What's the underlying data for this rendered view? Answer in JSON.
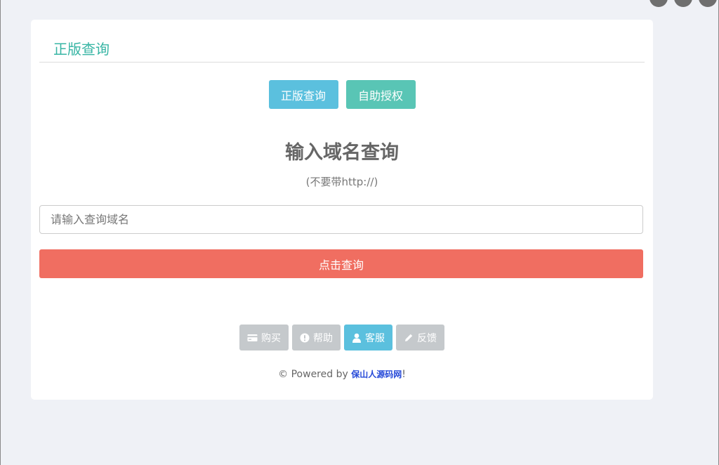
{
  "card": {
    "title": "正版查询"
  },
  "tabs": {
    "query_label": "正版查询",
    "authorize_label": "自助授权"
  },
  "main": {
    "heading": "输入域名查询",
    "subheading": "(不要带http://)",
    "input_placeholder": "请输入查询域名",
    "input_value": "",
    "submit_label": "点击查询"
  },
  "actions": {
    "buy": {
      "label": "购买",
      "icon": "credit-card-icon"
    },
    "help": {
      "label": "帮助",
      "icon": "exclamation-circle-icon"
    },
    "service": {
      "label": "客服",
      "icon": "user-icon"
    },
    "feedback": {
      "label": "反馈",
      "icon": "pencil-icon"
    }
  },
  "footer": {
    "prefix": "© Powered by ",
    "link_text": "保山人源码网",
    "suffix": "!"
  },
  "colors": {
    "accent_teal": "#37b5a4",
    "info_blue": "#5bc0de",
    "teal_button": "#59c5b5",
    "danger_red": "#f06e61",
    "gray_button": "#c5c9cc",
    "link_blue": "#2448d8"
  }
}
